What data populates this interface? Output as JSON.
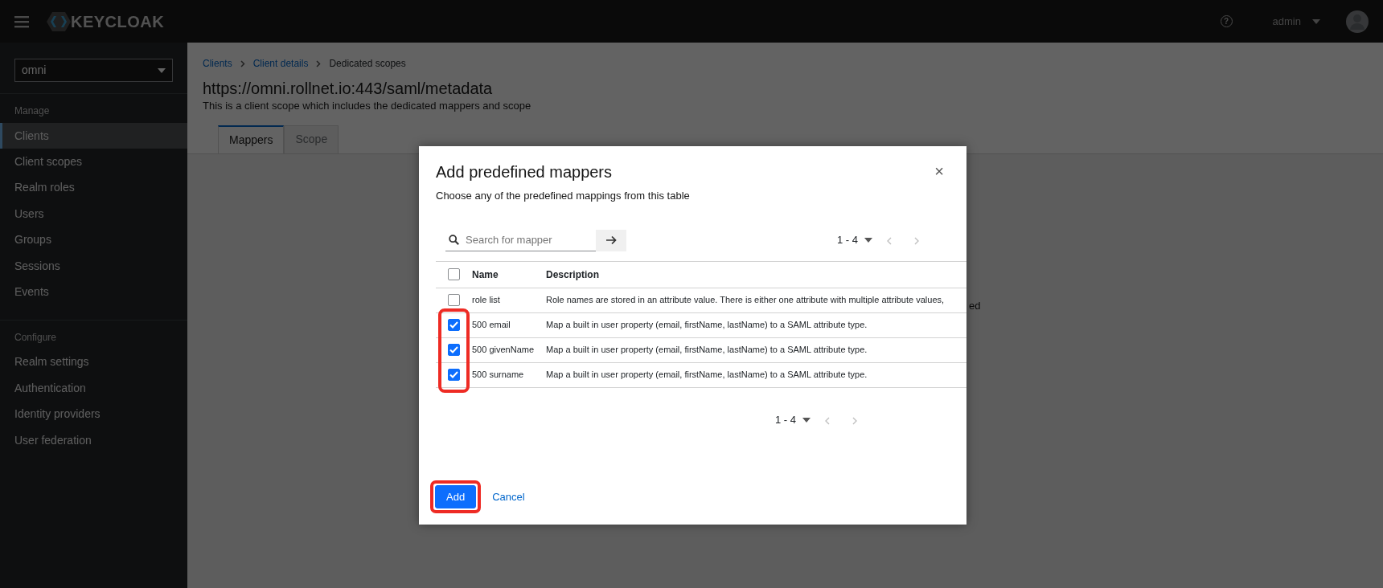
{
  "header": {
    "logo_text": "KEYCLOAK",
    "help": "?",
    "user": "admin"
  },
  "sidebar": {
    "realm": "omni",
    "sections": [
      {
        "title": "Manage",
        "items": [
          {
            "label": "Clients",
            "selected": true
          },
          {
            "label": "Client scopes",
            "selected": false
          },
          {
            "label": "Realm roles",
            "selected": false
          },
          {
            "label": "Users",
            "selected": false
          },
          {
            "label": "Groups",
            "selected": false
          },
          {
            "label": "Sessions",
            "selected": false
          },
          {
            "label": "Events",
            "selected": false
          }
        ]
      },
      {
        "title": "Configure",
        "items": [
          {
            "label": "Realm settings",
            "selected": false
          },
          {
            "label": "Authentication",
            "selected": false
          },
          {
            "label": "Identity providers",
            "selected": false
          },
          {
            "label": "User federation",
            "selected": false
          }
        ]
      }
    ]
  },
  "breadcrumb": [
    {
      "label": "Clients",
      "kind": "link"
    },
    {
      "label": "Client details",
      "kind": "link"
    },
    {
      "label": "Dedicated scopes",
      "kind": "current"
    }
  ],
  "page": {
    "title": "https://omni.rollnet.io:443/saml/metadata",
    "subtitle": "This is a client scope which includes the dedicated mappers and scope",
    "tabs": [
      {
        "label": "Mappers",
        "selected": true
      },
      {
        "label": "Scope",
        "selected": false
      }
    ],
    "background_fragment": "ed"
  },
  "modal": {
    "title": "Add predefined mappers",
    "subtitle": "Choose any of the predefined mappings from this table",
    "close": "×",
    "search": {
      "placeholder": "Search for mapper"
    },
    "pagination_top": {
      "range": "1 - 4"
    },
    "columns": [
      "Name",
      "Description"
    ],
    "select_all": false,
    "rows": [
      {
        "name": "role list",
        "description": "Role names are stored in an attribute value. There is either one attribute with multiple attribute values,",
        "checked": false,
        "highlighted": false
      },
      {
        "name": "500 email",
        "description": "Map a built in user property (email, firstName, lastName) to a SAML attribute type.",
        "checked": true,
        "highlighted": true
      },
      {
        "name": "500 givenName",
        "description": "Map a built in user property (email, firstName, lastName) to a SAML attribute type.",
        "checked": true,
        "highlighted": true
      },
      {
        "name": "500 surname",
        "description": "Map a built in user property (email, firstName, lastName) to a SAML attribute type.",
        "checked": true,
        "highlighted": true
      }
    ],
    "pagination_bottom": {
      "range": "1 - 4"
    },
    "buttons": [
      {
        "label": "Add",
        "kind": "primary",
        "highlighted": true
      },
      {
        "label": "Cancel",
        "kind": "link",
        "highlighted": false
      }
    ]
  }
}
